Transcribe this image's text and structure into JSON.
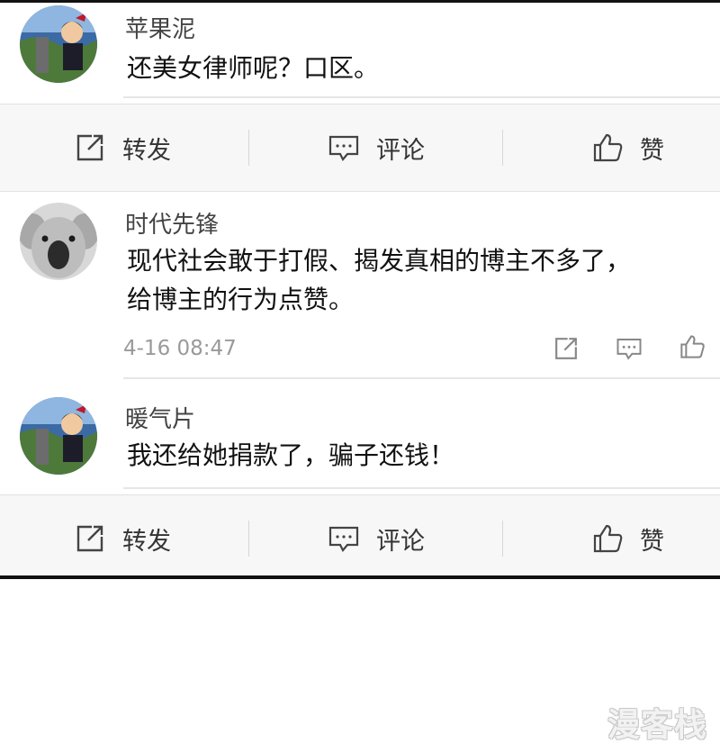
{
  "comments": [
    {
      "username": "苹果泥",
      "text": "还美女律师呢？口区。"
    },
    {
      "username": "时代先锋",
      "text_lines": [
        "现代社会敢于打假、揭发真相的博主不多了，",
        "给博主的行为点赞。"
      ],
      "timestamp": "4-16 08:47"
    },
    {
      "username": "暖气片",
      "text": "我还给她捐款了，骗子还钱！"
    }
  ],
  "actions": {
    "repost": "转发",
    "comment": "评论",
    "like": "赞"
  },
  "icons": {
    "repost": "share-icon",
    "comment": "comment-icon",
    "like": "thumbs-up-icon"
  },
  "watermark": "漫客栈"
}
